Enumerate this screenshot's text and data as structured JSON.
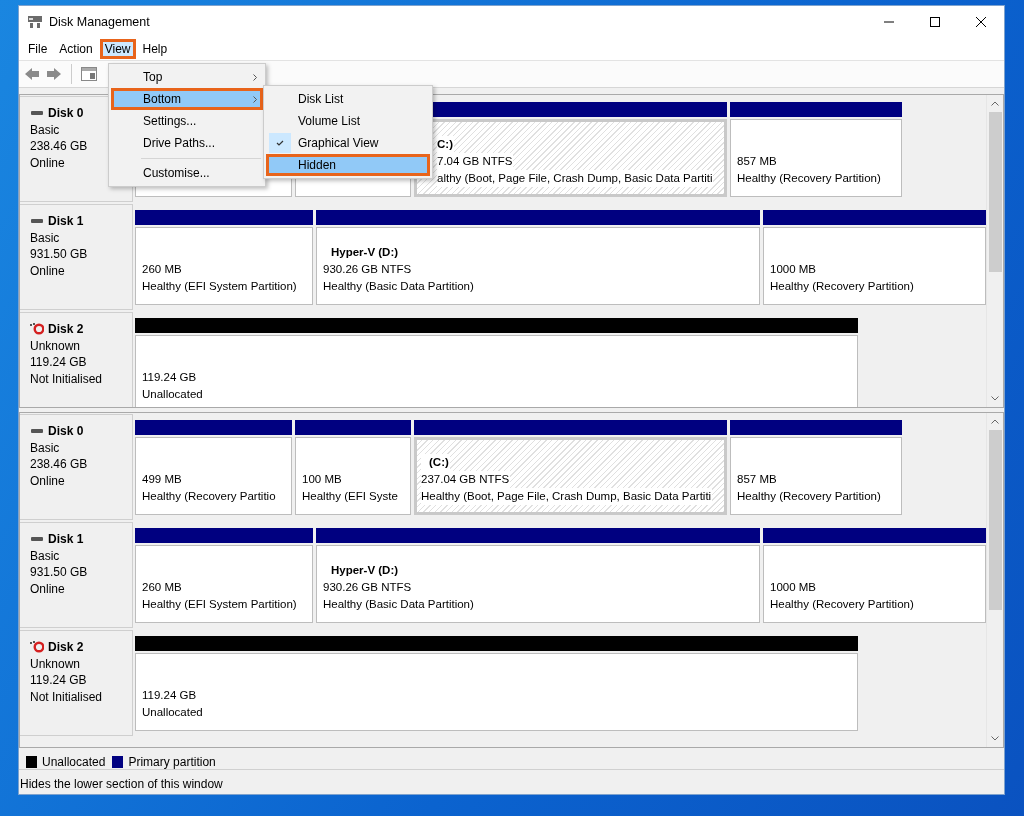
{
  "window": {
    "title": "Disk Management"
  },
  "menu_bar": [
    {
      "label": "File",
      "selected": false,
      "highlighted": false
    },
    {
      "label": "Action",
      "selected": false,
      "highlighted": false
    },
    {
      "label": "View",
      "selected": true,
      "highlighted": true
    },
    {
      "label": "Help",
      "selected": false,
      "highlighted": false
    }
  ],
  "view_menu": [
    {
      "kind": "item",
      "label": "Top",
      "submenu": true,
      "selected": false,
      "highlighted": false
    },
    {
      "kind": "item",
      "label": "Bottom",
      "submenu": true,
      "selected": true,
      "highlighted": true
    },
    {
      "kind": "item",
      "label": "Settings...",
      "submenu": false,
      "selected": false,
      "highlighted": false
    },
    {
      "kind": "item",
      "label": "Drive Paths...",
      "submenu": false,
      "selected": false,
      "highlighted": false
    },
    {
      "kind": "separator"
    },
    {
      "kind": "item",
      "label": "Customise...",
      "submenu": false,
      "selected": false,
      "highlighted": false
    }
  ],
  "bottom_submenu": [
    {
      "label": "Disk List",
      "checked": false,
      "selected": false,
      "highlighted": false
    },
    {
      "label": "Volume List",
      "checked": false,
      "selected": false,
      "highlighted": false
    },
    {
      "label": "Graphical View",
      "checked": true,
      "selected": false,
      "highlighted": false
    },
    {
      "label": "Hidden",
      "checked": false,
      "selected": true,
      "highlighted": true
    }
  ],
  "top_pane": {
    "disks": [
      {
        "kind": "basic",
        "name": "Disk 0",
        "type": "Basic",
        "size": "238.46 GB",
        "status": "Online",
        "partitions": [
          {
            "kind": "primary",
            "selected": false
          },
          {
            "kind": "primary",
            "selected": false
          },
          {
            "kind": "primary",
            "volume": "C:)",
            "size": "7.04 GB NTFS",
            "status": "althy (Boot, Page File, Crash Dump, Basic Data Partiti",
            "selected": true
          },
          {
            "kind": "primary",
            "size": "857 MB",
            "status": "Healthy (Recovery Partition)",
            "selected": false
          }
        ]
      },
      {
        "kind": "basic",
        "name": "Disk 1",
        "type": "Basic",
        "size": "931.50 GB",
        "status": "Online",
        "partitions": [
          {
            "kind": "primary",
            "size": "260 MB",
            "status": "Healthy (EFI System Partition)",
            "selected": false
          },
          {
            "kind": "primary",
            "volume": "Hyper-V  (D:)",
            "size": "930.26 GB NTFS",
            "status": "Healthy (Basic Data Partition)",
            "selected": false
          },
          {
            "kind": "primary",
            "size": "1000 MB",
            "status": "Healthy (Recovery Partition)",
            "selected": false
          }
        ]
      },
      {
        "kind": "unknown",
        "name": "Disk 2",
        "type": "Unknown",
        "size": "119.24 GB",
        "status": "Not Initialised",
        "partitions": [
          {
            "kind": "unallocated",
            "size": "119.24 GB",
            "status": "Unallocated",
            "selected": false
          }
        ]
      }
    ]
  },
  "bottom_pane": {
    "disks": [
      {
        "kind": "basic",
        "name": "Disk 0",
        "type": "Basic",
        "size": "238.46 GB",
        "status": "Online",
        "partitions": [
          {
            "kind": "primary",
            "size": "499 MB",
            "status": "Healthy (Recovery Partitio",
            "selected": false
          },
          {
            "kind": "primary",
            "size": "100 MB",
            "status": "Healthy (EFI Syste",
            "selected": false
          },
          {
            "kind": "primary",
            "volume": "(C:)",
            "size": "237.04 GB NTFS",
            "status": "Healthy (Boot, Page File, Crash Dump, Basic Data Partiti",
            "selected": true
          },
          {
            "kind": "primary",
            "size": "857 MB",
            "status": "Healthy (Recovery Partition)",
            "selected": false
          }
        ]
      },
      {
        "kind": "basic",
        "name": "Disk 1",
        "type": "Basic",
        "size": "931.50 GB",
        "status": "Online",
        "partitions": [
          {
            "kind": "primary",
            "size": "260 MB",
            "status": "Healthy (EFI System Partition)",
            "selected": false
          },
          {
            "kind": "primary",
            "volume": "Hyper-V  (D:)",
            "size": "930.26 GB NTFS",
            "status": "Healthy (Basic Data Partition)",
            "selected": false
          },
          {
            "kind": "primary",
            "size": "1000 MB",
            "status": "Healthy (Recovery Partition)",
            "selected": false
          }
        ]
      },
      {
        "kind": "unknown",
        "name": "Disk 2",
        "type": "Unknown",
        "size": "119.24 GB",
        "status": "Not Initialised",
        "partitions": [
          {
            "kind": "unallocated",
            "size": "119.24 GB",
            "status": "Unallocated",
            "selected": false
          }
        ]
      }
    ]
  },
  "legend": [
    {
      "label": "Unallocated",
      "color": "#000000"
    },
    {
      "label": "Primary partition",
      "color": "#000080"
    }
  ],
  "status_bar": "Hides the lower section of this window"
}
